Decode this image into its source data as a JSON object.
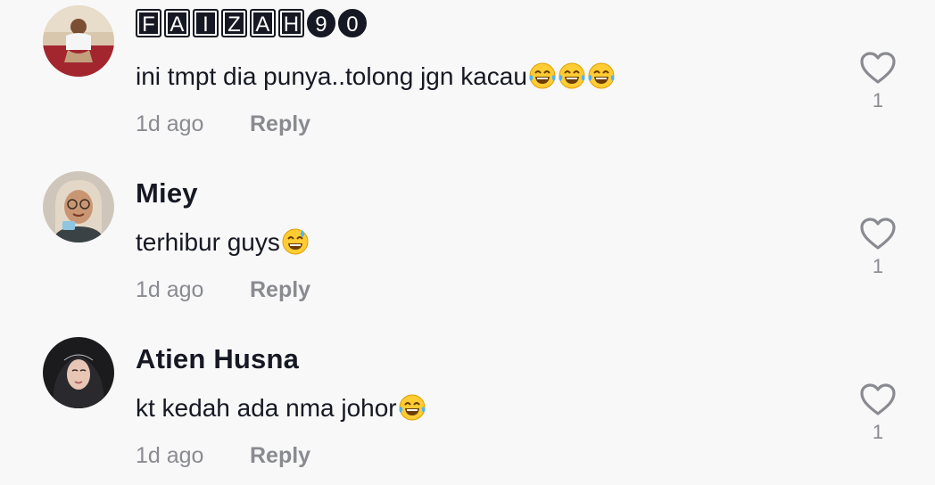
{
  "comments": [
    {
      "username_glyphs": [
        "F",
        "A",
        "I",
        "Z",
        "A",
        "H",
        "9",
        "0"
      ],
      "username_plain": "FAIZAH90",
      "text": "ini tmpt dia punya..tolong jgn kacau",
      "emojis": [
        "joy-emoji",
        "joy-emoji",
        "joy-emoji"
      ],
      "time": "1d ago",
      "reply_label": "Reply",
      "likes": "1"
    },
    {
      "username": "Miey",
      "text": "terhibur guys",
      "emojis": [
        "sweat-smile-emoji"
      ],
      "time": "1d ago",
      "reply_label": "Reply",
      "likes": "1"
    },
    {
      "username": "Atien Husna",
      "text": "kt kedah ada nma johor",
      "emojis": [
        "joy-emoji"
      ],
      "time": "1d ago",
      "reply_label": "Reply",
      "likes": "1"
    }
  ],
  "colors": {
    "background": "#f8f8f8",
    "text_primary": "#161823",
    "text_secondary": "#8a8b91"
  }
}
